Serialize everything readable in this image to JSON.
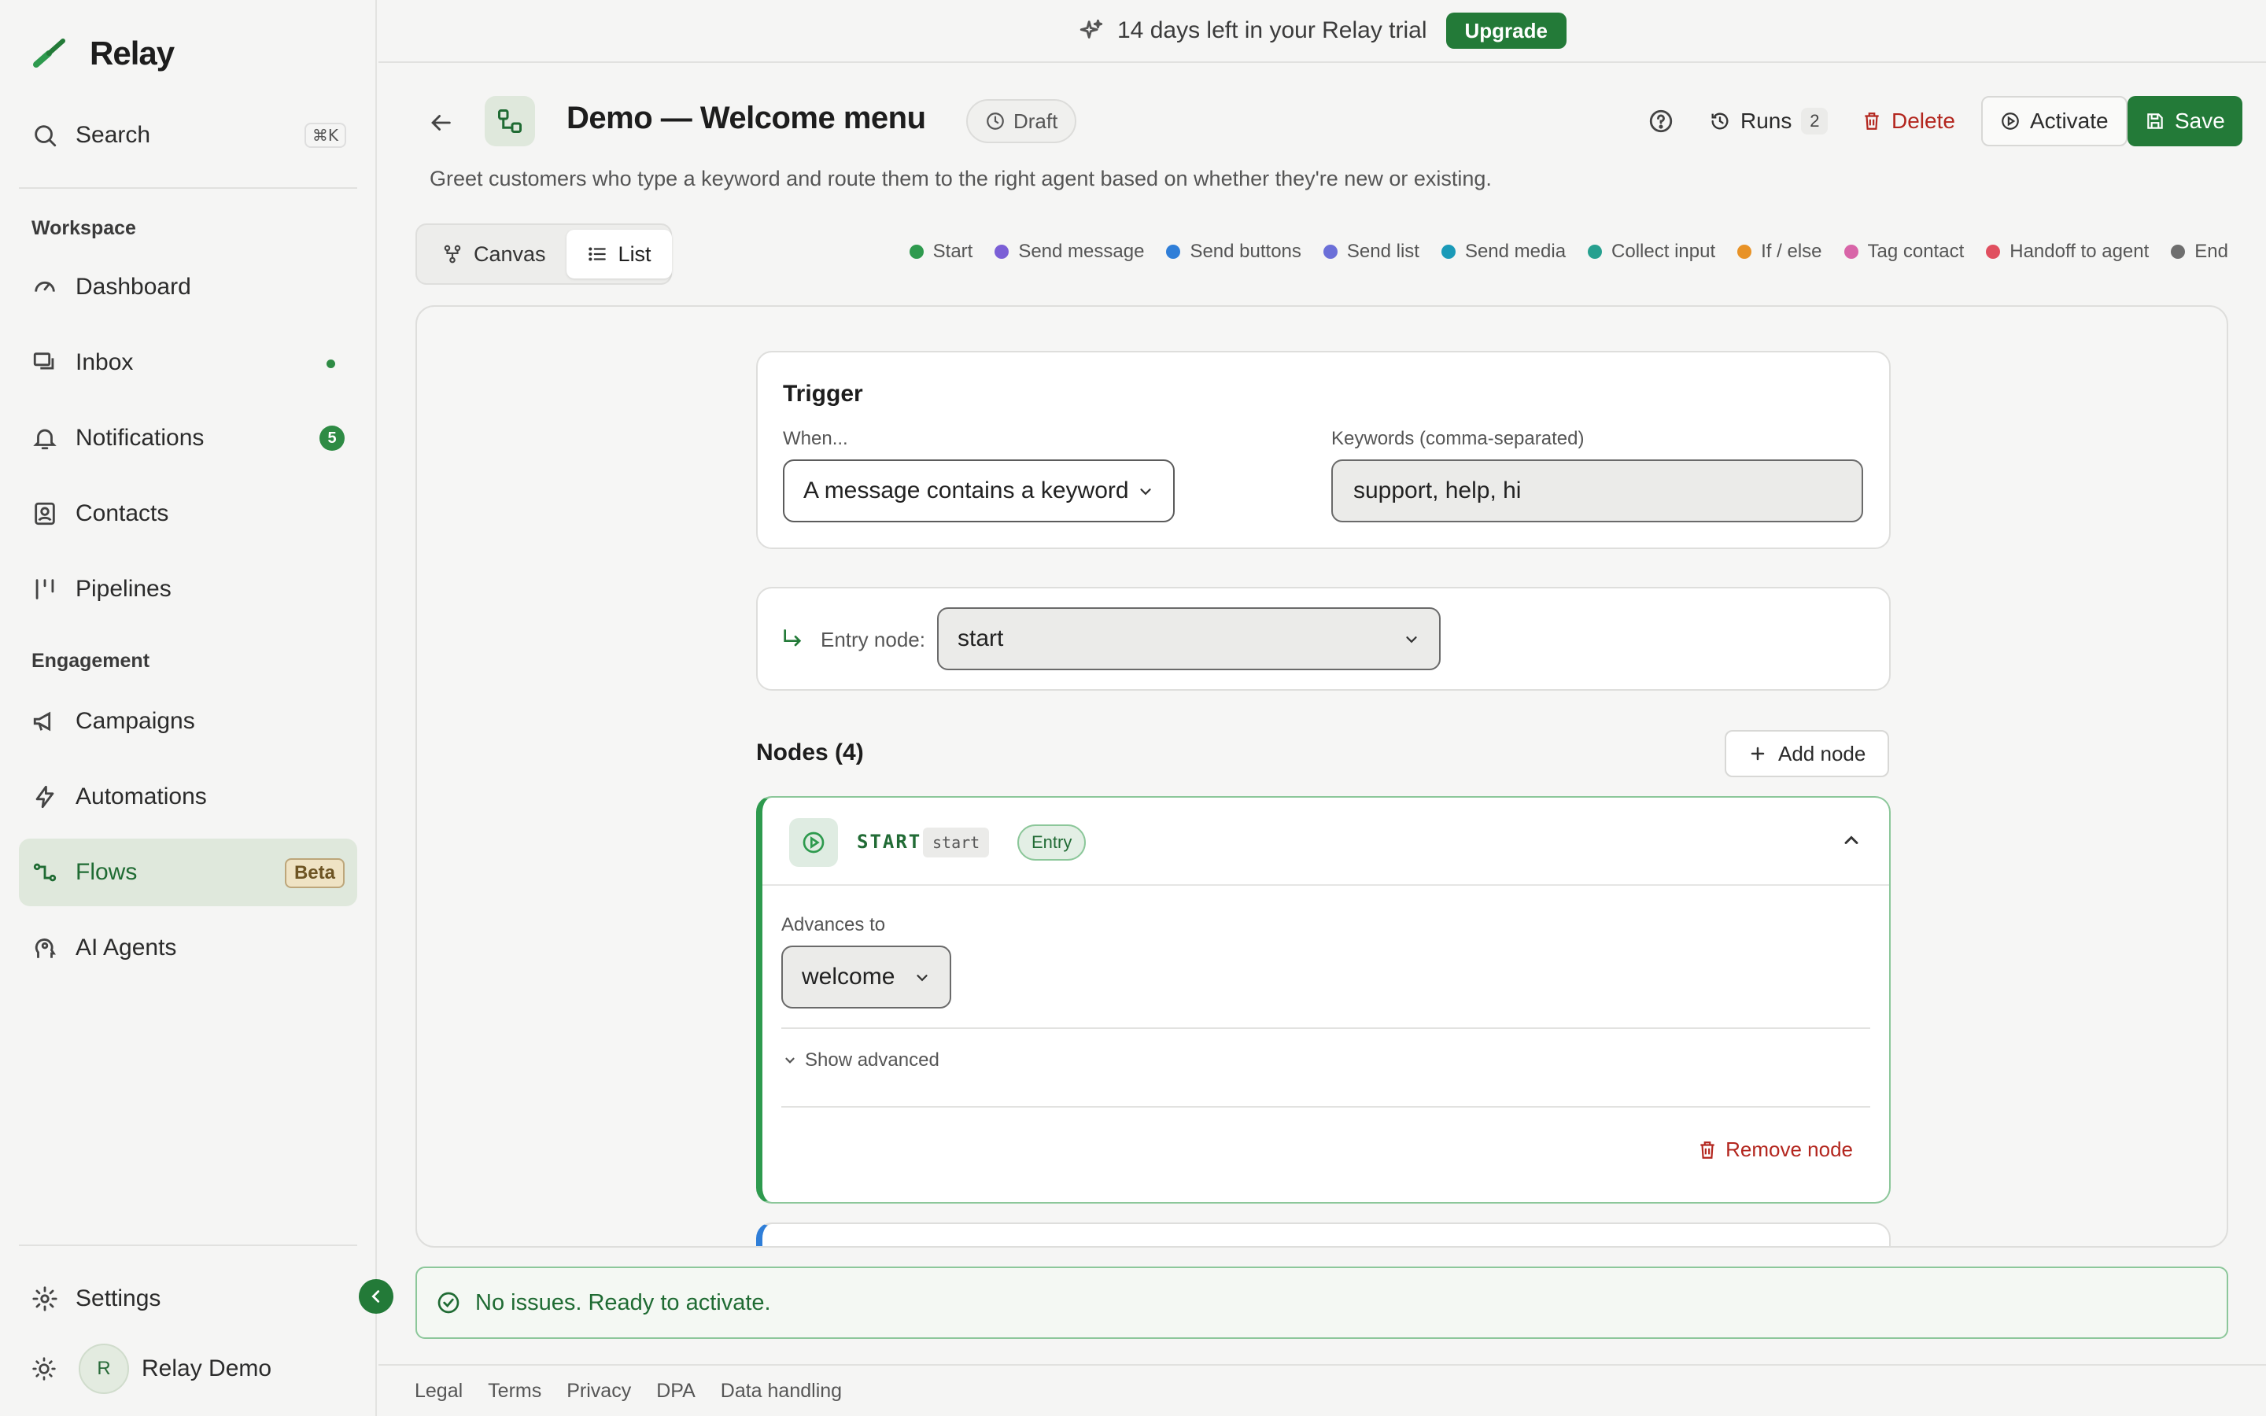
{
  "app": {
    "name": "Relay"
  },
  "sidebar": {
    "search_label": "Search",
    "search_shortcut": "⌘K",
    "sections": {
      "workspace": "Workspace",
      "engagement": "Engagement"
    },
    "items": [
      {
        "label": "Dashboard",
        "icon": "gauge-icon"
      },
      {
        "label": "Inbox",
        "icon": "chat-icon",
        "indicator": "dot"
      },
      {
        "label": "Notifications",
        "icon": "bell-icon",
        "badge": "5"
      },
      {
        "label": "Contacts",
        "icon": "contacts-icon"
      },
      {
        "label": "Pipelines",
        "icon": "pipeline-icon"
      },
      {
        "label": "Campaigns",
        "icon": "megaphone-icon"
      },
      {
        "label": "Automations",
        "icon": "bolt-icon"
      },
      {
        "label": "Flows",
        "icon": "flows-icon",
        "badge": "Beta",
        "active": true
      },
      {
        "label": "AI Agents",
        "icon": "ai-head-icon"
      }
    ],
    "settings_label": "Settings",
    "user": {
      "initial": "R",
      "name": "Relay Demo"
    }
  },
  "trial": {
    "text": "14 days left in your Relay trial",
    "button": "Upgrade"
  },
  "header": {
    "title": "Demo — Welcome menu",
    "status": "Draft",
    "runs_label": "Runs",
    "runs_count": "2",
    "delete_label": "Delete",
    "activate_label": "Activate",
    "save_label": "Save",
    "description": "Greet customers who type a keyword and route them to the right agent based on whether they're new or existing."
  },
  "view_toggle": {
    "canvas": "Canvas",
    "list": "List",
    "active": "list"
  },
  "legend": [
    {
      "label": "Start",
      "color": "#2e9a4e"
    },
    {
      "label": "Send message",
      "color": "#7b5fd6"
    },
    {
      "label": "Send buttons",
      "color": "#2f7ed8"
    },
    {
      "label": "Send list",
      "color": "#6b6fd8"
    },
    {
      "label": "Send media",
      "color": "#1a9ab8"
    },
    {
      "label": "Collect input",
      "color": "#26a08f"
    },
    {
      "label": "If / else",
      "color": "#e89226"
    },
    {
      "label": "Tag contact",
      "color": "#d865a8"
    },
    {
      "label": "Handoff to agent",
      "color": "#e04f5f"
    },
    {
      "label": "End",
      "color": "#6e6e6e"
    }
  ],
  "trigger": {
    "title": "Trigger",
    "when_label": "When...",
    "when_value": "A message contains a keyword",
    "keywords_label": "Keywords (comma-separated)",
    "keywords_value": "support, help, hi"
  },
  "entry": {
    "label": "Entry node:",
    "value": "start"
  },
  "nodes": {
    "title": "Nodes (4)",
    "add_label": "Add node",
    "first": {
      "type": "START",
      "id": "start",
      "badge": "Entry",
      "advances_label": "Advances to",
      "advances_value": "welcome",
      "show_advanced": "Show advanced",
      "remove_label": "Remove node"
    }
  },
  "status_message": "No issues. Ready to activate.",
  "footer": [
    "Legal",
    "Terms",
    "Privacy",
    "DPA",
    "Data handling"
  ]
}
